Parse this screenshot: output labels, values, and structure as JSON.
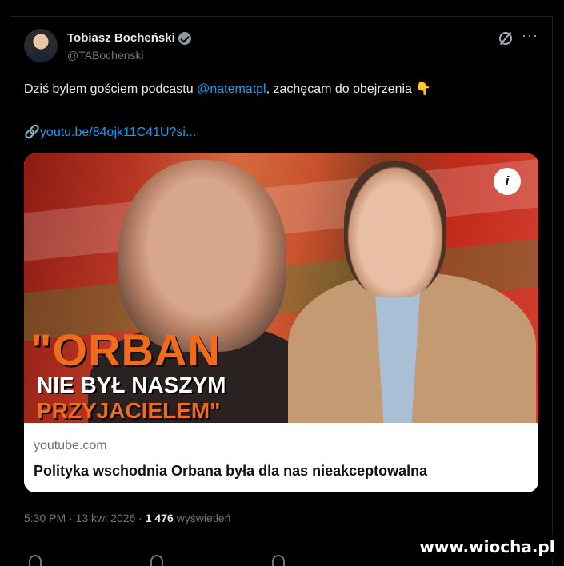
{
  "author": {
    "name": "Tobiasz Bocheński",
    "handle": "@TABochenski"
  },
  "tweet": {
    "text_before": "Dziś bylem gościem podcastu ",
    "mention": "@natematpl",
    "text_after": ", zachęcam do obejrzenia 👇",
    "link_icon": "🔗",
    "link": "youtu.be/84ojk11C41U?si..."
  },
  "card": {
    "headline_line1": "\"ORBAN",
    "headline_line2": "NIE BYŁ NASZYM",
    "headline_line3": "PRZYJACIELEM\"",
    "info_label": "i",
    "domain": "youtube.com",
    "title": "Polityka wschodnia Orbana była dla nas nieakceptowalna"
  },
  "meta": {
    "time": "5:30 PM · 13 kwi 2026 · ",
    "views_count": "1 476",
    "views_label": " wyświetleń"
  },
  "watermark": "www.wiocha.pl",
  "colors": {
    "background": "#000000",
    "link": "#1d9bf0",
    "headline_orange": "#f26a1b",
    "muted": "#71767b"
  },
  "icons": [
    "verified-icon",
    "grok-icon",
    "more-icon",
    "link-icon",
    "info-icon",
    "reply-icon",
    "repost-icon",
    "like-icon"
  ]
}
